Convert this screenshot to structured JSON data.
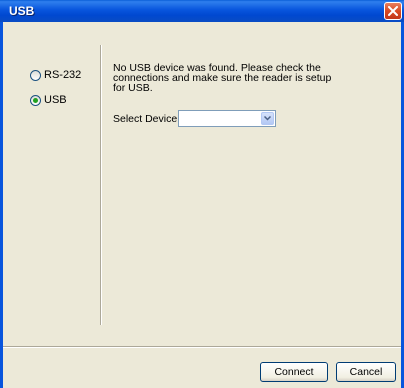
{
  "window": {
    "title": "USB",
    "close_icon": "close-icon"
  },
  "connection": {
    "options": [
      {
        "label": "RS-232",
        "selected": false
      },
      {
        "label": "USB",
        "selected": true
      }
    ]
  },
  "message": {
    "text": "No USB device was found. Please check the connections and make sure the reader is setup for USB."
  },
  "device": {
    "label": "Select Device:",
    "value": ""
  },
  "buttons": {
    "connect": "Connect",
    "cancel": "Cancel"
  },
  "colors": {
    "titlebar": "#0855dd",
    "dialog_bg": "#ece9d8",
    "close_button": "#d84a23",
    "radio_dot": "#21a121"
  }
}
